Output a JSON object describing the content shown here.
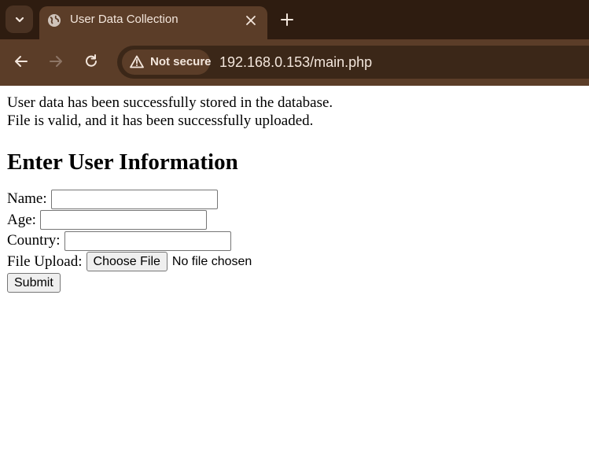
{
  "browser": {
    "tab_title": "User Data Collection",
    "security_label": "Not secure",
    "url": "192.168.0.153/main.php",
    "icons": {
      "tab_search": "chevron-down-icon",
      "favicon": "globe-icon",
      "close": "close-icon",
      "new_tab": "plus-icon",
      "back": "back-arrow-icon",
      "forward": "forward-arrow-icon",
      "reload": "reload-icon",
      "warning": "warning-triangle-icon"
    },
    "colors": {
      "tabstrip": "#2e1c10",
      "toolbar": "#5b3d28",
      "omnibox": "#3b2718",
      "text": "#f3e6dc"
    }
  },
  "page": {
    "messages": [
      "User data has been successfully stored in the database.",
      "File is valid, and it has been successfully uploaded."
    ],
    "form_title": "Enter User Information",
    "form": {
      "name_label": "Name:",
      "name_value": "",
      "age_label": "Age:",
      "age_value": "",
      "country_label": "Country:",
      "country_value": "",
      "file_label": "File Upload:",
      "file_button": "Choose File",
      "file_status": "No file chosen",
      "submit_label": "Submit"
    }
  }
}
